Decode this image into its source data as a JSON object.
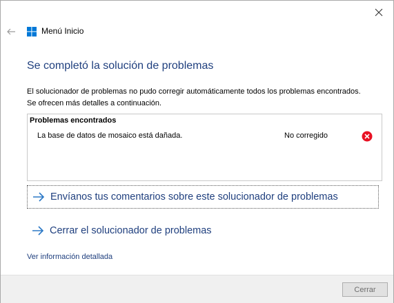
{
  "window": {
    "title": "Menú Inicio",
    "back_icon": "back-arrow-icon",
    "close_icon": "close-icon"
  },
  "main": {
    "heading": "Se completó la solución de problemas",
    "description": "El solucionador de problemas no pudo corregir automáticamente todos los problemas encontrados. Se ofrecen más detalles a continuación."
  },
  "problems": {
    "header": "Problemas encontrados",
    "items": [
      {
        "description": "La base de datos de mosaico está dañada.",
        "status": "No corregido",
        "status_icon": "error-icon"
      }
    ]
  },
  "links": {
    "feedback": "Envíanos tus comentarios sobre este solucionador de problemas",
    "close_troubleshooter": "Cerrar el solucionador de problemas",
    "details": "Ver información detallada"
  },
  "footer": {
    "close_label": "Cerrar"
  },
  "colors": {
    "accent": "#1f3f7e",
    "link_arrow": "#2b78c6",
    "error": "#e81123",
    "windows_blue": "#0078d7"
  }
}
